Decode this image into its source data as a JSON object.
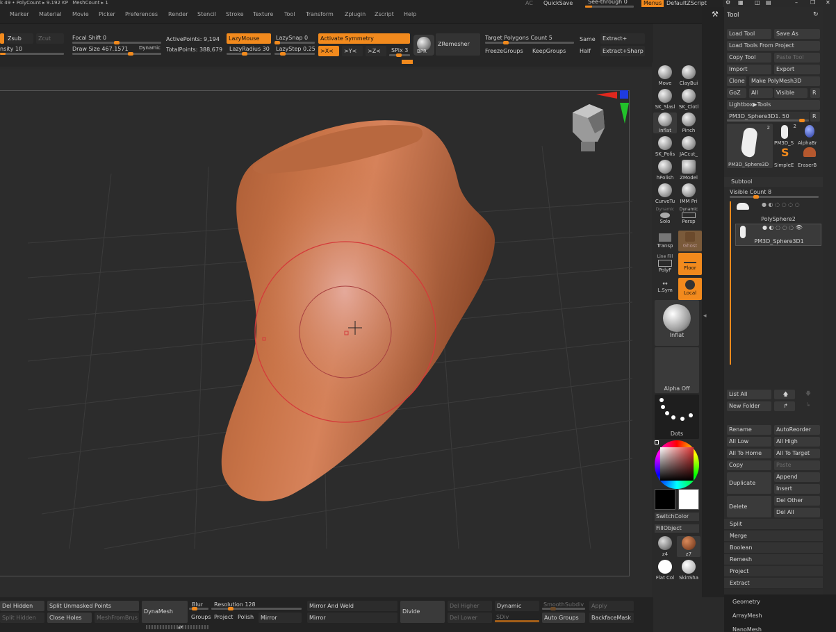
{
  "info": {
    "left": "k 49 •",
    "polycount": "PolyCount ▸ 9.192 KP",
    "meshcount": "MeshCount ▸ 1"
  },
  "menu": {
    "items": [
      "Marker",
      "Material",
      "Movie",
      "Picker",
      "Preferences",
      "Render",
      "Stencil",
      "Stroke",
      "Texture",
      "Tool",
      "Transform",
      "Zplugin",
      "Zscript",
      "Help"
    ],
    "ac": "AC",
    "quicksave": "QuickSave",
    "see_through": "See-through  0",
    "menus": "Menus",
    "default_zscript": "DefaultZScript"
  },
  "topshelf": {
    "zsub": "Zsub",
    "zcut": "Zcut",
    "intensity": "nsity 10",
    "focal_shift": "Focal Shift 0",
    "draw_size": "Draw Size 467.1571",
    "dynamic": "Dynamic",
    "active_points": "ActivePoints: 9,194",
    "total_points": "TotalPoints: 388,679",
    "lazymouse": "LazyMouse",
    "lazyradius": "LazyRadius 30",
    "lazysnap": "LazySnap 0",
    "lazystep": "LazyStep 0.25",
    "activate_symmetry": "Activate Symmetry",
    "sym_x": ">X<",
    "sym_y": ">Y<",
    "sym_z": ">Z<",
    "spix": "SPix 3",
    "bpr": "BPR",
    "zremesher": "ZRemesher",
    "target_polygons": "Target Polygons Count 5",
    "freezegroups": "FreezeGroups",
    "keepgroups": "KeepGroups",
    "same": "Same",
    "half": "Half",
    "extract_plus": "Extract+",
    "extract_sharp": "Extract+Sharp"
  },
  "shelf": {
    "move": "Move",
    "claybuild": "ClayBui",
    "sk_slash": "SK_Slasl",
    "sk_cloth": "SK_Clotl",
    "inflat": "Inflat",
    "pinch": "Pinch",
    "sk_polish": "SK_Polis",
    "jacut": "JACcut_",
    "hpolish": "hPolish",
    "zmodeler": "ZModel",
    "curvetube": "CurveTu",
    "imm_pri": "IMM Pri",
    "dynamic_solo": "Dynamic",
    "solo": "Solo",
    "dynamic_persp": "Dynamic",
    "persp": "Persp",
    "transp": "Transp",
    "ghost": "Ghost",
    "polyf": "PolyF",
    "line_fill": "Line Fill",
    "floor": "Floor",
    "lsym": "L.Sym",
    "local": "Local",
    "inflat_big": "Inflat",
    "alpha_off": "Alpha Off",
    "dots": "Dots",
    "switchcolor": "SwitchColor",
    "fillobject": "FillObject",
    "mat_z4": "z4",
    "mat_z7": "z7",
    "flat_color": "Flat Col",
    "skin_shade": "SkinSha"
  },
  "tool": {
    "title": "Tool",
    "load_tool": "Load Tool",
    "save_as": "Save As",
    "load_tools_from_project": "Load Tools From Project",
    "copy_tool": "Copy Tool",
    "paste_tool": "Paste Tool",
    "import": "Import",
    "export": "Export",
    "clone": "Clone",
    "make_polymesh": "Make PolyMesh3D",
    "goz": "GoZ",
    "all": "All",
    "visible": "Visible",
    "r": "R",
    "lightbox_tools": "Lightbox▶Tools",
    "current_tool": "PM3D_Sphere3D1. 50",
    "thumb_main_label": "PM3D_Sphere3D",
    "thumb_main_count": "2",
    "thumb_2_label": "PM3D_S",
    "thumb_2_count": "2",
    "thumb_alpha": "AlphaBr",
    "thumb_simple": "SimpleE",
    "thumb_eraser": "EraserB"
  },
  "subtool": {
    "title": "Subtool",
    "visible_count": "Visible Count 8",
    "items": [
      "PolySphere2",
      "PM3D_Sphere3D1"
    ],
    "list_all": "List All",
    "new_folder": "New Folder",
    "rename": "Rename",
    "autoreorder": "AutoReorder",
    "all_low": "All Low",
    "all_high": "All High",
    "all_to_home": "All To Home",
    "all_to_target": "All To Target",
    "copy": "Copy",
    "paste": "Paste",
    "duplicate": "Duplicate",
    "append": "Append",
    "insert": "Insert",
    "delete": "Delete",
    "del_other": "Del Other",
    "del_all": "Del All",
    "sections": [
      "Split",
      "Merge",
      "Boolean",
      "Remesh",
      "Project",
      "Extract"
    ]
  },
  "palettes": [
    "Geometry",
    "ArrayMesh",
    "NanoMesh"
  ],
  "bottom": {
    "del_hidden": "Del Hidden",
    "split_hidden": "Split Hidden",
    "split_unmasked": "Split Unmasked Points",
    "close_holes": "Close Holes",
    "mesh_from_brush": "MeshFromBrus",
    "dynamesh": "DynaMesh",
    "blur": "Blur",
    "groups": "Groups",
    "project": "Project",
    "polish": "Polish",
    "resolution": "Resolution 128",
    "mirror_and_weld": "Mirror And Weld",
    "mirror_a": "Mirror",
    "mirror_b": "Mirror",
    "divide": "Divide",
    "del_higher": "Del Higher",
    "del_lower": "Del Lower",
    "dynamic": "Dynamic",
    "sdiv": "SDiv",
    "smooth_subdiv": "SmoothSubdiv",
    "apply": "Apply",
    "auto_groups": "Auto Groups",
    "backface_mask": "BackfaceMask"
  },
  "colors": {
    "accent": "#f28a1d",
    "mesh": "#c46c3d",
    "brush_ring": "#d43a3a"
  }
}
